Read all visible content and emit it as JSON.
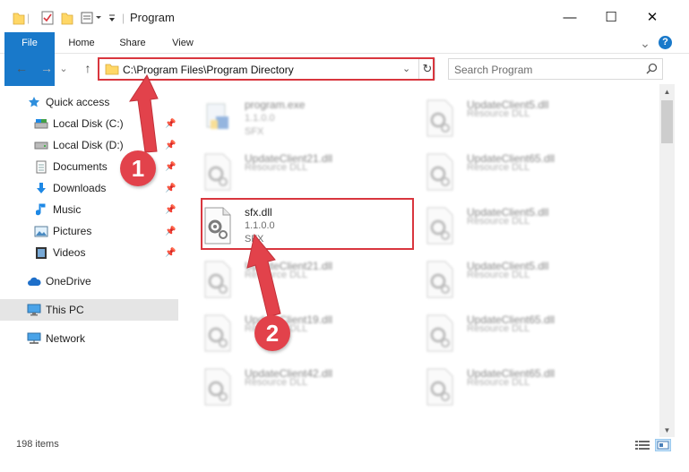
{
  "window": {
    "title": "Program",
    "controls": {
      "minimize": "—",
      "maximize": "☐",
      "close": "✕"
    }
  },
  "ribbon": {
    "tabs": [
      {
        "label": "File"
      },
      {
        "label": "Home"
      },
      {
        "label": "Share"
      },
      {
        "label": "View"
      }
    ],
    "expand": "⌄",
    "help": "?"
  },
  "nav": {
    "back": "←",
    "forward": "→",
    "recent": "⌄",
    "up": "↑",
    "address": "C:\\Program Files\\Program Directory",
    "search_placeholder": "Search Program"
  },
  "sidebar": {
    "items": [
      {
        "label": "Quick access",
        "icon": "star-icon"
      },
      {
        "label": "Local Disk (C:)",
        "icon": "drive-icon"
      },
      {
        "label": "Local Disk (D:)",
        "icon": "drive-icon"
      },
      {
        "label": "Documents",
        "icon": "documents-icon"
      },
      {
        "label": "Downloads",
        "icon": "download-icon"
      },
      {
        "label": "Music",
        "icon": "music-icon"
      },
      {
        "label": "Pictures",
        "icon": "pictures-icon"
      },
      {
        "label": "Videos",
        "icon": "videos-icon"
      },
      {
        "label": "OneDrive",
        "icon": "cloud-icon"
      },
      {
        "label": "This PC",
        "icon": "computer-icon"
      },
      {
        "label": "Network",
        "icon": "network-icon"
      }
    ]
  },
  "files": [
    {
      "name": "program.exe",
      "version": "1.1.0.0",
      "desc": "SFX",
      "kind": "exe"
    },
    {
      "name": "UpdateClient5.dll",
      "version": "",
      "desc": "Resource DLL",
      "kind": "dll"
    },
    {
      "name": "UpdateClient21.dll",
      "version": "",
      "desc": "Resource DLL",
      "kind": "dll"
    },
    {
      "name": "UpdateClient65.dll",
      "version": "",
      "desc": "Resource DLL",
      "kind": "dll"
    },
    {
      "name": "sfx.dll",
      "version": "1.1.0.0",
      "desc": "SFX",
      "kind": "dll"
    },
    {
      "name": "UpdateClient5.dll",
      "version": "",
      "desc": "Resource DLL",
      "kind": "dll"
    },
    {
      "name": "UpdateClient21.dll",
      "version": "",
      "desc": "Resource DLL",
      "kind": "dll"
    },
    {
      "name": "UpdateClient5.dll",
      "version": "",
      "desc": "Resource DLL",
      "kind": "dll"
    },
    {
      "name": "UpdateClient19.dll",
      "version": "",
      "desc": "Resource DLL",
      "kind": "dll"
    },
    {
      "name": "UpdateClient65.dll",
      "version": "",
      "desc": "Resource DLL",
      "kind": "dll"
    },
    {
      "name": "UpdateClient42.dll",
      "version": "",
      "desc": "Resource DLL",
      "kind": "dll"
    },
    {
      "name": "UpdateClient65.dll",
      "version": "",
      "desc": "Resource DLL",
      "kind": "dll"
    }
  ],
  "status": {
    "count": "198 items"
  },
  "annotations": {
    "step1": "1",
    "step2": "2"
  },
  "colors": {
    "accent": "#1979ca",
    "highlight": "#d9363e",
    "selected_bg": "#e5e5e5"
  }
}
